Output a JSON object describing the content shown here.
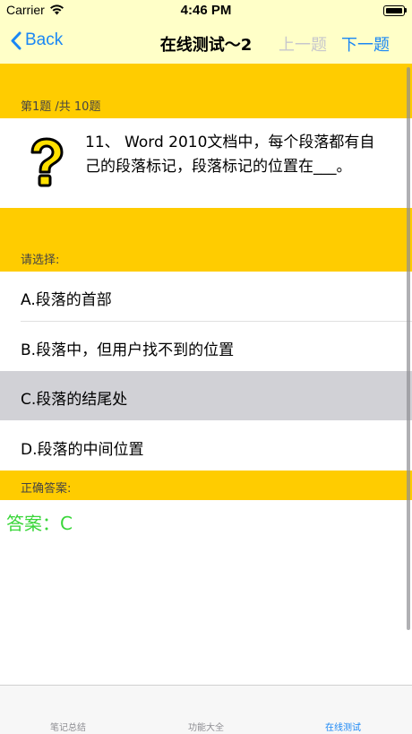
{
  "status": {
    "carrier": "Carrier",
    "time": "4:46 PM"
  },
  "nav": {
    "back": "Back",
    "title": "在线测试～2",
    "prev": "上一题",
    "next": "下一题"
  },
  "progress": "第1题 /共 10题",
  "question": {
    "text": "11、 Word 2010文档中，每个段落都有自己的段落标记，段落标记的位置在___。"
  },
  "choose_label": "请选择:",
  "options": [
    {
      "label": "A.段落的首部",
      "selected": false
    },
    {
      "label": "B.段落中，但用户找不到的位置",
      "selected": false
    },
    {
      "label": "C.段落的结尾处",
      "selected": true
    },
    {
      "label": "D.段落的中间位置",
      "selected": false
    }
  ],
  "correct_label": "正确答案:",
  "answer": "答案：C",
  "tabs": [
    {
      "label": "笔记总结",
      "active": false
    },
    {
      "label": "功能大全",
      "active": false
    },
    {
      "label": "在线测试",
      "active": true
    }
  ],
  "colors": {
    "accent": "#1a87f5",
    "section": "#ffcc00",
    "navbar": "#ffffc8",
    "answer": "#39d639",
    "selected": "#d1d1d6"
  },
  "icons": {
    "question": "question-mark-icon",
    "back": "chevron-left-icon"
  }
}
